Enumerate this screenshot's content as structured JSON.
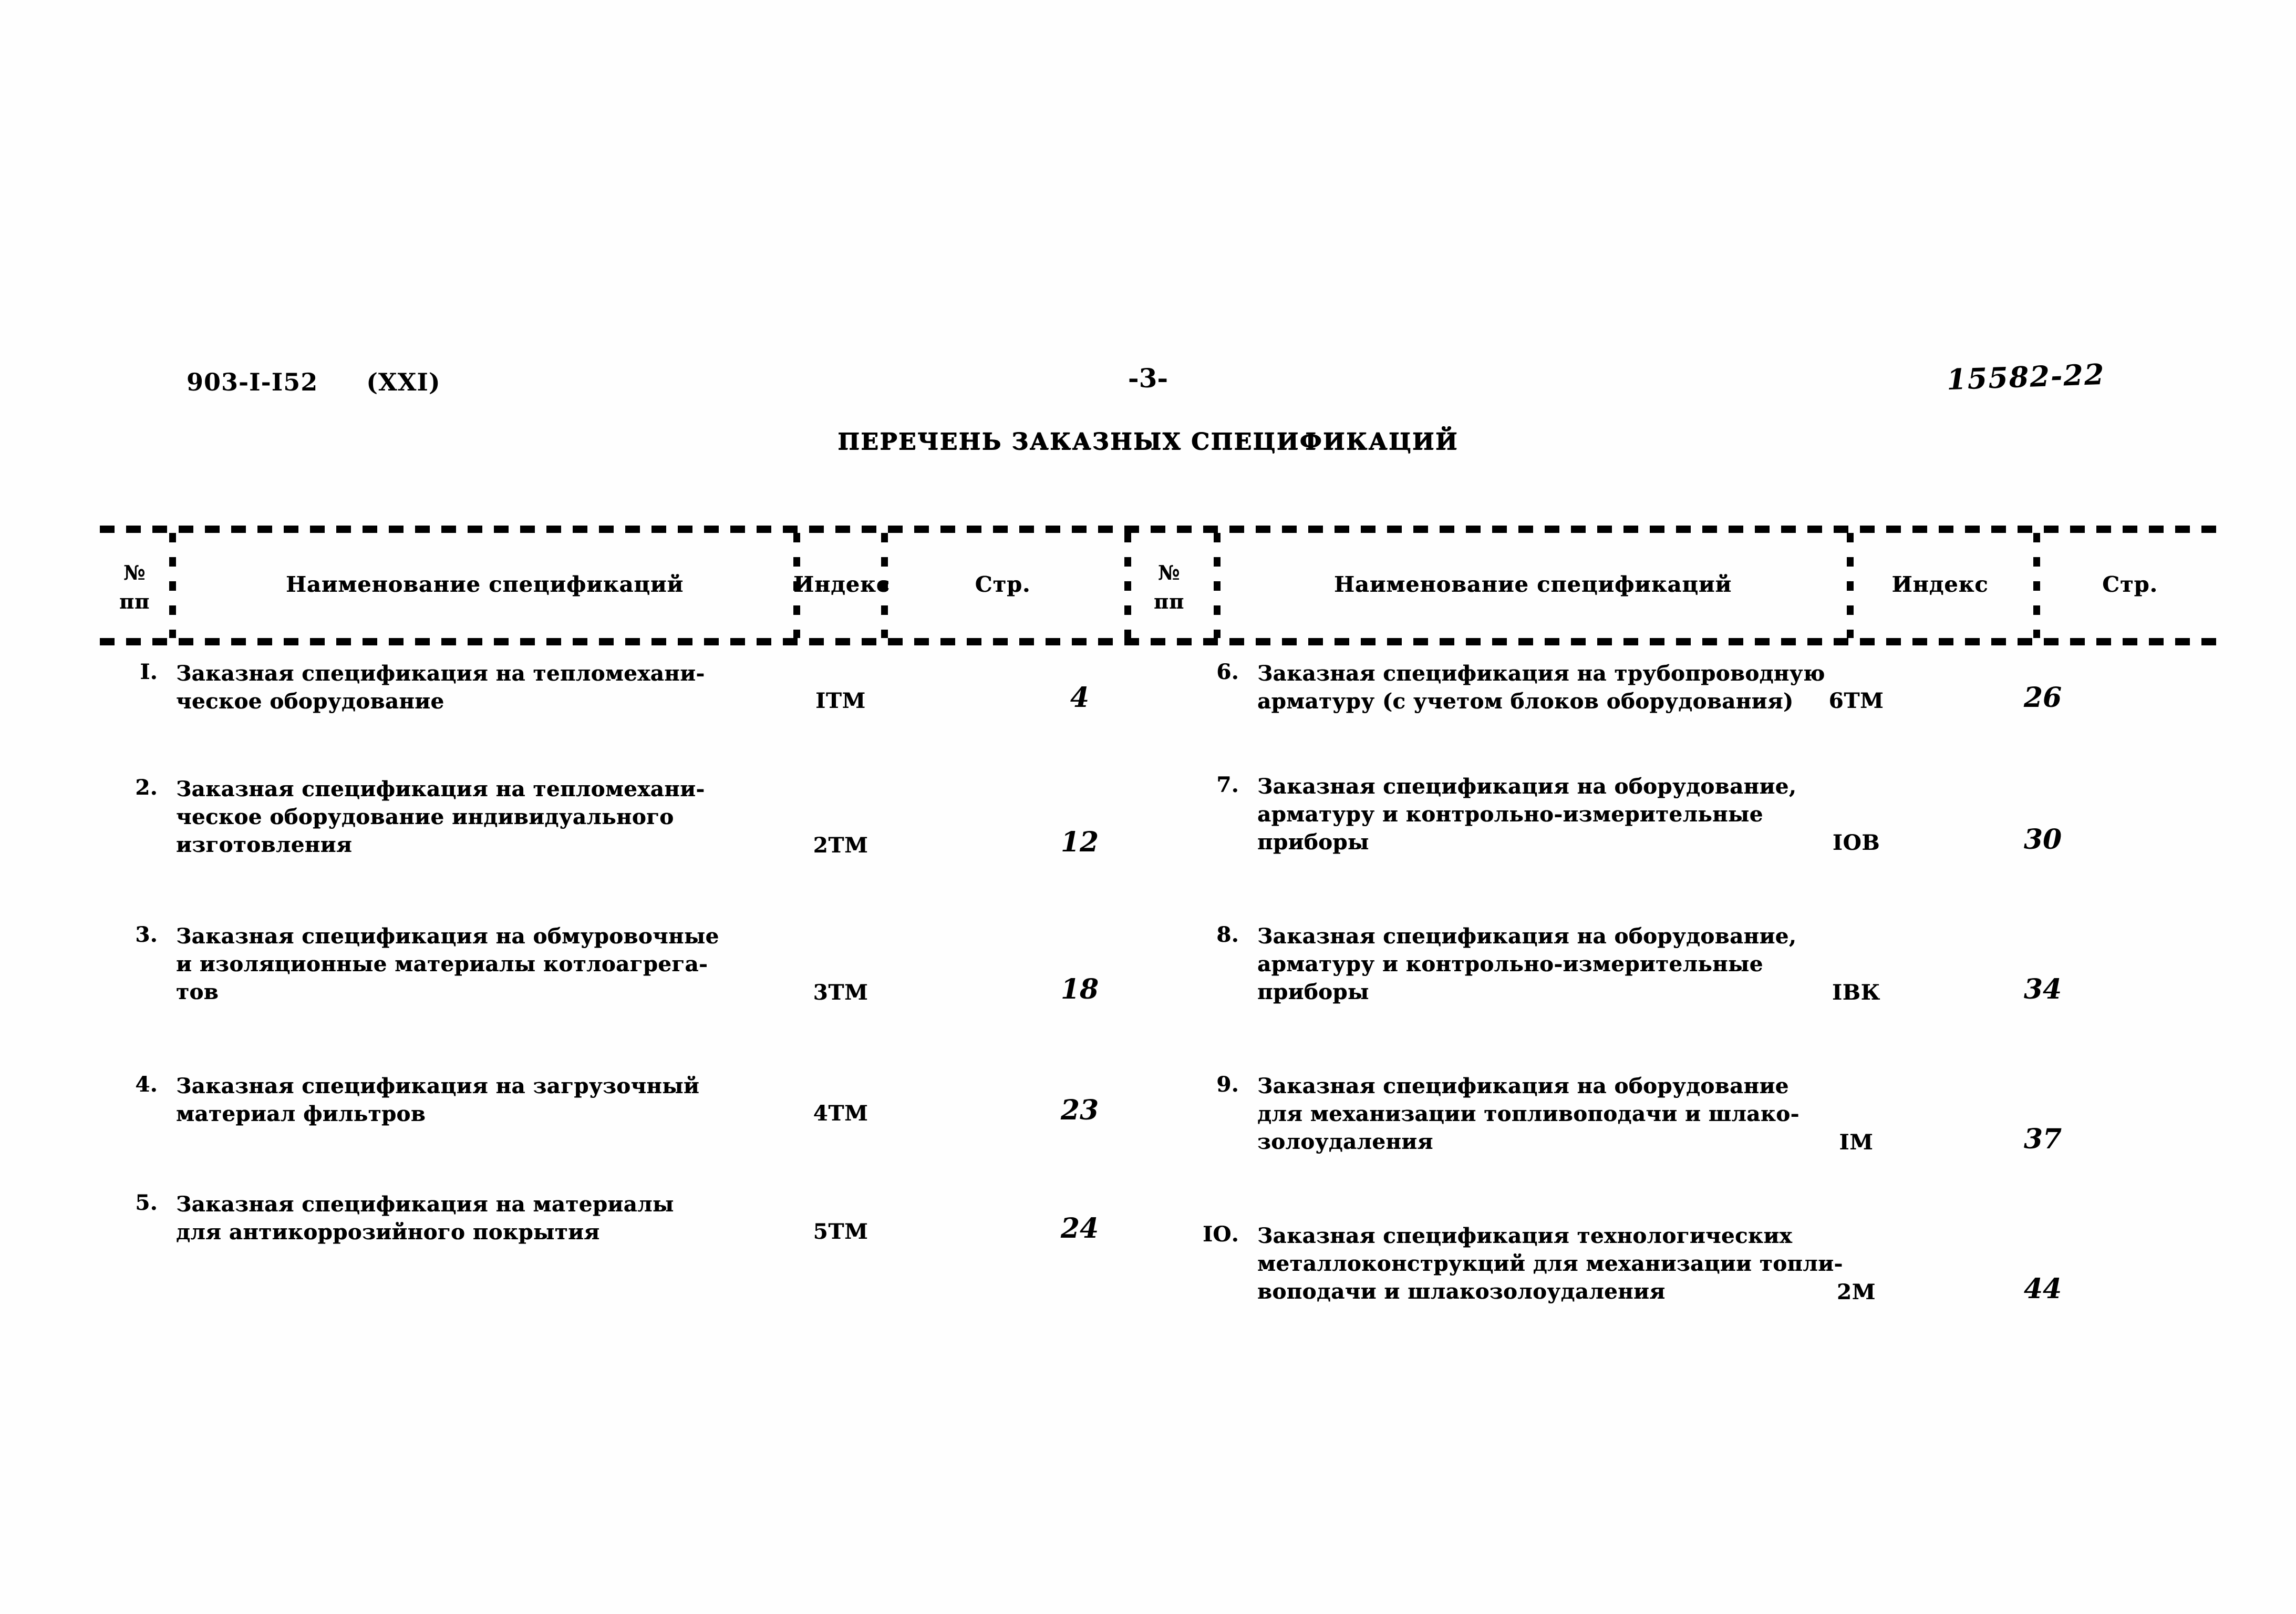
{
  "header": {
    "project_code": "903-I-I52",
    "variant": "(XXI)",
    "page_number": "-3-",
    "archive_stamp": "15582-22",
    "title": "ПЕРЕЧЕНЬ ЗАКАЗНЫХ СПЕЦИФИКАЦИЙ"
  },
  "table": {
    "columns": [
      {
        "num": "№\nпп",
        "name": "Наименование спецификаций",
        "index": "Индекс",
        "page": "Стр."
      },
      {
        "num": "№\nпп",
        "name": "Наименование спецификаций",
        "index": "Индекс",
        "page": "Стр."
      }
    ],
    "headers": {
      "num_line1": "№",
      "num_line2": "пп",
      "name": "Наименование спецификаций",
      "index": "Индекс",
      "page": "Стр."
    },
    "left_rows": [
      {
        "num": "I.",
        "name": "Заказная спецификация на тепломехани-\nческое оборудование",
        "index": "IТМ",
        "page": "4"
      },
      {
        "num": "2.",
        "name": "Заказная спецификация на тепломехани-\nческое оборудование индивидуального\nизготовления",
        "index": "2ТМ",
        "page": "12"
      },
      {
        "num": "3.",
        "name": "Заказная спецификация на обмуровочные\nи изоляционные материалы котлоагрега-\nтов",
        "index": "3ТМ",
        "page": "18"
      },
      {
        "num": "4.",
        "name": "Заказная спецификация на загрузочный\nматериал фильтров",
        "index": "4ТМ",
        "page": "23"
      },
      {
        "num": "5.",
        "name": "Заказная спецификация на материалы\nдля антикоррозийного покрытия",
        "index": "5ТМ",
        "page": "24"
      }
    ],
    "right_rows": [
      {
        "num": "6.",
        "name": "Заказная спецификация на трубопроводную\nарматуру (с учетом блоков оборудования)",
        "index": "6ТМ",
        "page": "26"
      },
      {
        "num": "7.",
        "name": "Заказная спецификация на оборудование,\nарматуру и контрольно-измерительные\nприборы",
        "index": "IОВ",
        "page": "30"
      },
      {
        "num": "8.",
        "name": "Заказная спецификация на оборудование,\nарматуру и контрольно-измерительные\nприборы",
        "index": "IВК",
        "page": "34"
      },
      {
        "num": "9.",
        "name": "Заказная спецификация на оборудование\nдля механизации топливоподачи и шлако-\nзолоудаления",
        "index": "IМ",
        "page": "37"
      },
      {
        "num": "IО.",
        "name": "Заказная спецификация технологических\nметаллоконструкций для механизации топли-\nвоподачи и шлакозолоудаления",
        "index": "2М",
        "page": "44"
      }
    ]
  }
}
